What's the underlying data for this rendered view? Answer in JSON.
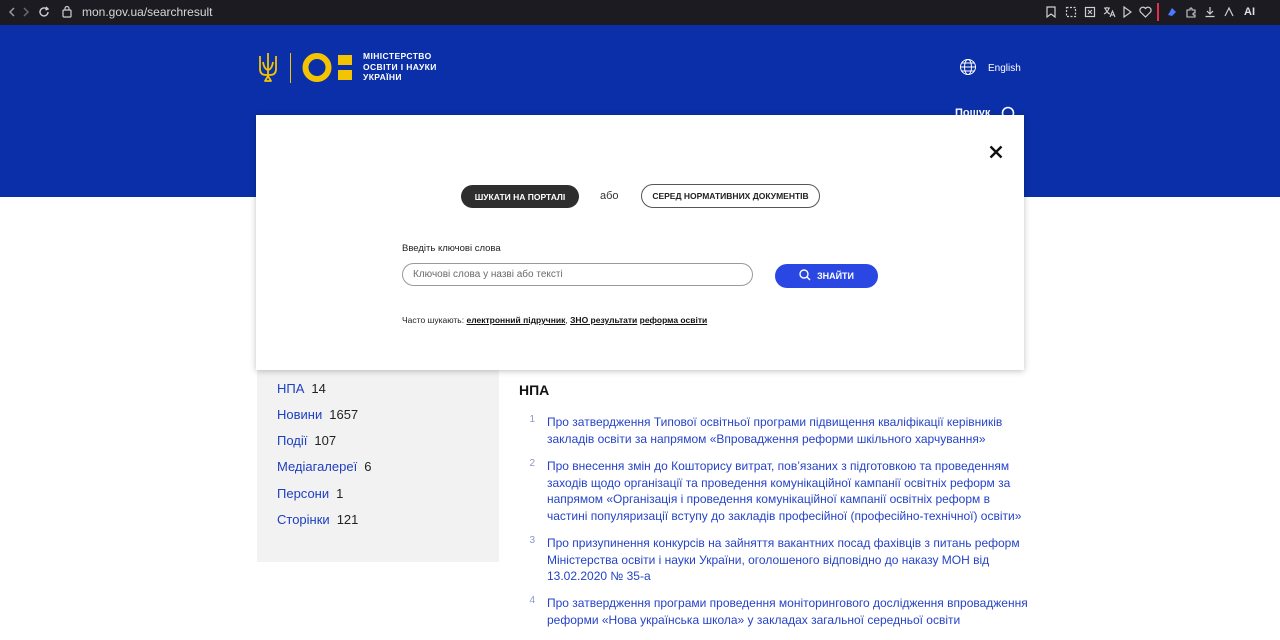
{
  "browser": {
    "url": "mon.gov.ua/searchresult",
    "ai_label": "AI"
  },
  "header": {
    "logo_lines": [
      "МІНІСТЕРСТВО",
      "ОСВІТИ І НАУКИ",
      "УКРАЇНИ"
    ],
    "language_label": "English",
    "search_label": "Пошук",
    "colors": {
      "header_bg": "#0a2fa8",
      "logo_yellow": "#f5c400"
    }
  },
  "modal": {
    "tabs": {
      "portal_label": "ШУКАТИ НА ПОРТАЛІ",
      "or_label": "або",
      "documents_label": "СЕРЕД НОРМАТИВНИХ ДОКУМЕНТІВ",
      "active": "portal"
    },
    "field_label": "Введіть ключові слова",
    "input_value": "",
    "input_placeholder": "Ключові слова у назві або тексті",
    "find_label": "ЗНАЙТИ",
    "popular_label": "Часто шукають:",
    "popular_links": [
      "електронний підручник",
      "ЗНО результати",
      "реформа освіти"
    ],
    "popular_separator": ",",
    "colors": {
      "find_bg": "#2a46e3",
      "active_tab_bg": "#2e2e2e"
    }
  },
  "sidebar": {
    "categories": [
      {
        "name": "НПА",
        "count": "14"
      },
      {
        "name": "Новини",
        "count": "1657"
      },
      {
        "name": "Події",
        "count": "107"
      },
      {
        "name": "Медіагалереї",
        "count": "6"
      },
      {
        "name": "Персони",
        "count": "1"
      },
      {
        "name": "Сторінки",
        "count": "121"
      }
    ]
  },
  "results": {
    "title": "НПА",
    "items": [
      {
        "num": "1",
        "title": "Про затвердження Типової освітньої програми підвищення кваліфікації керівників закладів освіти за напрямом «Впровадження реформи шкільного харчування»"
      },
      {
        "num": "2",
        "title": "Про внесення змін до Кошторису витрат, пов’язаних з підготовкою та проведенням заходів щодо організації та проведення комунікаційної кампанії освітніх реформ за напрямом «Організація і проведення комунікаційної кампанії освітніх реформ в частині популяризації вступу до закладів професійної (професійно-технічної) освіти»"
      },
      {
        "num": "3",
        "title": "Про призупинення конкурсів на зайняття вакантних посад фахівців з питань реформ Міністерства освіти і науки України, оголошеного відповідно до наказу МОН від 13.02.2020 № 35-а"
      },
      {
        "num": "4",
        "title": "Про затвердження програми проведення моніторингового дослідження впровадження реформи «Нова українська школа» у закладах загальної середньої освіти"
      }
    ]
  }
}
